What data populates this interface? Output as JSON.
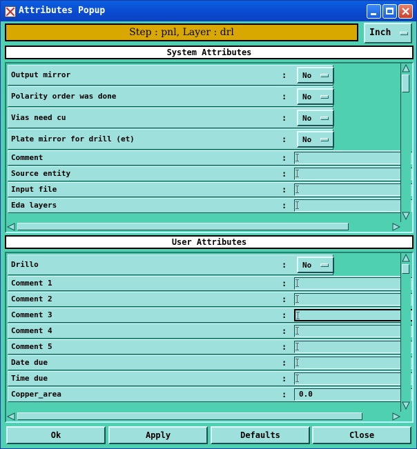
{
  "window": {
    "title": "Attributes Popup"
  },
  "step_bar": {
    "label": "Step : pnl, Layer : drl"
  },
  "units": {
    "selected": "Inch"
  },
  "system": {
    "header": "System Attributes",
    "rows": [
      {
        "label": "Output mirror",
        "type": "option",
        "value": "No"
      },
      {
        "label": "Polarity order was done",
        "type": "option",
        "value": "No"
      },
      {
        "label": "Vias need cu",
        "type": "option",
        "value": "No"
      },
      {
        "label": "Plate mirror for drill (et)",
        "type": "option",
        "value": "No"
      },
      {
        "label": "Comment",
        "type": "text",
        "value": ""
      },
      {
        "label": "Source entity",
        "type": "text",
        "value": ""
      },
      {
        "label": "Input file",
        "type": "text",
        "value": ""
      },
      {
        "label": "Eda layers",
        "type": "text",
        "value": ""
      }
    ]
  },
  "user": {
    "header": "User Attributes",
    "rows": [
      {
        "label": "Drillo",
        "type": "option",
        "value": "No"
      },
      {
        "label": "Comment 1",
        "type": "text",
        "value": ""
      },
      {
        "label": "Comment 2",
        "type": "text",
        "value": ""
      },
      {
        "label": "Comment 3",
        "type": "text",
        "value": "",
        "active": true
      },
      {
        "label": "Comment 4",
        "type": "text",
        "value": ""
      },
      {
        "label": "Comment 5",
        "type": "text",
        "value": ""
      },
      {
        "label": "Date due",
        "type": "text",
        "value": ""
      },
      {
        "label": "Time due",
        "type": "text",
        "value": ""
      },
      {
        "label": "Copper_area",
        "type": "text",
        "value": "0.0"
      }
    ]
  },
  "separator": ":",
  "buttons": {
    "ok": "Ok",
    "apply": "Apply",
    "defaults": "Defaults",
    "close": "Close"
  },
  "colors": {
    "panel": "#4fd0b0",
    "field": "#9ee0dc",
    "step_bar": "#d9a800",
    "titlebar": "#0a4ad0"
  }
}
